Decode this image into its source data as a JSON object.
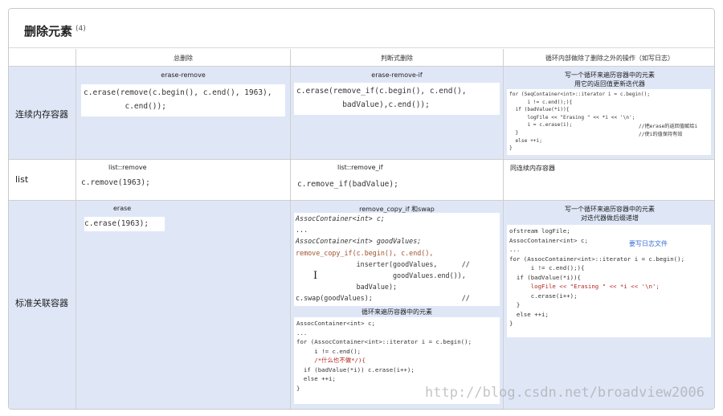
{
  "page": {
    "title": "删除元素",
    "title_sup": "(4)",
    "watermark": "http://blog.csdn.net/broadview2006"
  },
  "header": {
    "col1": "总删除",
    "col2": "判断式删除",
    "col3": "循环内部做除了删除之外的操作（如写日志）"
  },
  "rows": {
    "contiguous": {
      "label": "连续内存容器",
      "c1_title": "erase-remove",
      "c1_lines": [
        "c.erase(remove(c.begin(), c.end(), 1963),",
        "         c.end());"
      ],
      "c2_title": "erase-remove-if",
      "c2_lines": [
        "c.erase(remove_if(c.begin(), c.end(),",
        "          badValue),c.end());"
      ],
      "c3_title_1": "写一个循环来遍历容器中的元素",
      "c3_title_2": "用它的返回值更新迭代器",
      "c3_lines": [
        "for (SeqContainer<int>::iterator i = c.begin();",
        "      i != c.end();){",
        "  if (badValue(*i)){",
        "      logFile << \"Erasing \" << *i << '\\n';",
        "      i = c.erase(i);",
        "  }",
        "  else ++i;",
        "}"
      ],
      "c3_note_1": "//把erase的返回值赋给i",
      "c3_note_2": "//使i的值保持有效"
    },
    "list": {
      "label": "list",
      "c1_title": "list::remove",
      "c1_code": "c.remove(1963);",
      "c2_title": "list::remove_if",
      "c2_code": "c.remove_if(badValue);",
      "c3_text": "同连续内存容器"
    },
    "assoc": {
      "label": "标准关联容器",
      "c1_title": "erase",
      "c1_code": "c.erase(1963);",
      "c2_title": "remove_copy_if 和swap",
      "c2_lines": [
        "AssocContainer<int> c;",
        "...",
        "AssocContainer<int> goodValues;",
        "remove_copy_if(c.begin(), c.end(),",
        "               inserter(goodValues,      //",
        "                        goodValues.end()),",
        "               badValue);",
        "c.swap(goodValues);                      //"
      ],
      "c2_title_b": "循环来遍历容器中的元素",
      "c2_lines_b": [
        "AssocContainer<int> c;",
        "...",
        "for (AssocContainer<int>::iterator i = c.begin();",
        "     i != c.end();",
        "     /*什么也不做*/){",
        "  if (badValue(*i)) c.erase(i++);",
        "  else ++i;",
        "}"
      ],
      "c3_title_1": "写一个循环来遍历容器中的元素",
      "c3_title_2": "对迭代器做后缀递增",
      "c3_lines": [
        "ofstream logFile;",
        "AssocContainer<int> c;",
        "...",
        "for (AssocContainer<int>::iterator i = c.begin();",
        "      i != c.end();){",
        "  if (badValue(*i)){",
        "      logFile << \"Erasing \" << *i << '\\n';",
        "      c.erase(i++);",
        "  }",
        "  else ++i;",
        "}"
      ],
      "c3_note": "要写日志文件"
    }
  },
  "colors": {
    "row_blue": "#dfe7f7",
    "border": "#cfcfcf",
    "note_blue": "#3b6fd8"
  }
}
